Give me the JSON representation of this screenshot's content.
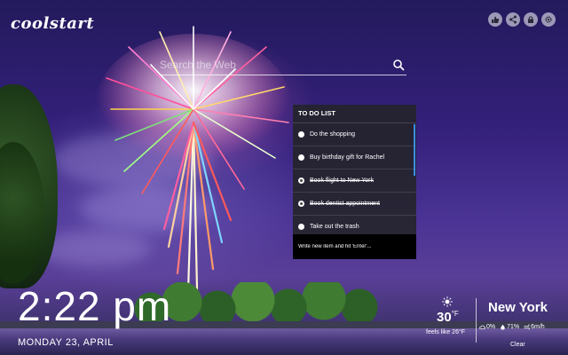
{
  "brand": {
    "logo_text": "coolstart"
  },
  "top_icons": [
    "thumbs-up-icon",
    "share-icon",
    "lock-icon",
    "gear-icon"
  ],
  "search": {
    "placeholder": "Search the Web",
    "icon": "search-icon"
  },
  "todo": {
    "title": "TO DO LIST",
    "items": [
      {
        "text": "Do the shopping",
        "done": false
      },
      {
        "text": "Buy birthday gift for Rachel",
        "done": false
      },
      {
        "text": "Book flight to New York",
        "done": true
      },
      {
        "text": "Book dentist appointment",
        "done": true
      },
      {
        "text": "Take out the trash",
        "done": false
      }
    ],
    "input_placeholder": "Write new item and hit 'Enter'..."
  },
  "clock": {
    "time": "2:22 pm",
    "date": "MONDAY 23, APRIL"
  },
  "weather": {
    "icon": "sun-icon",
    "temp": "30",
    "unit": "°F",
    "feels_like": "feels like 26°F",
    "city": "New York",
    "precip": "0%",
    "humidity": "71%",
    "wind": "6m/h",
    "condition": "Clear"
  }
}
